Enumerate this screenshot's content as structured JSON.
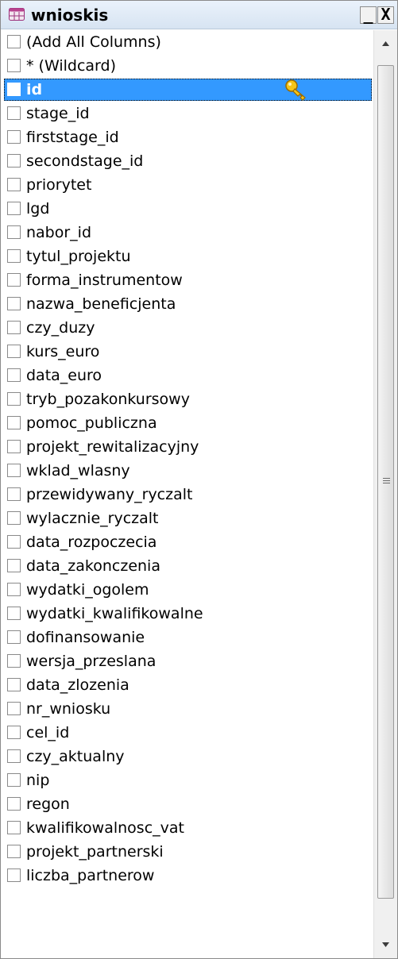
{
  "window": {
    "title": "wnioskis",
    "icon": "table-icon",
    "minimize_label": "_",
    "close_label": "X"
  },
  "columns": {
    "selected_index": 2,
    "items": [
      {
        "label": "(Add All Columns)",
        "checked": false
      },
      {
        "label": "* (Wildcard)",
        "checked": false
      },
      {
        "label": "id",
        "checked": false,
        "primary_key": true
      },
      {
        "label": "stage_id",
        "checked": false
      },
      {
        "label": "firststage_id",
        "checked": false
      },
      {
        "label": "secondstage_id",
        "checked": false
      },
      {
        "label": "priorytet",
        "checked": false
      },
      {
        "label": "lgd",
        "checked": false
      },
      {
        "label": "nabor_id",
        "checked": false
      },
      {
        "label": "tytul_projektu",
        "checked": false
      },
      {
        "label": "forma_instrumentow",
        "checked": false
      },
      {
        "label": "nazwa_beneficjenta",
        "checked": false
      },
      {
        "label": "czy_duzy",
        "checked": false
      },
      {
        "label": "kurs_euro",
        "checked": false
      },
      {
        "label": "data_euro",
        "checked": false
      },
      {
        "label": "tryb_pozakonkursowy",
        "checked": false
      },
      {
        "label": "pomoc_publiczna",
        "checked": false
      },
      {
        "label": "projekt_rewitalizacyjny",
        "checked": false
      },
      {
        "label": "wklad_wlasny",
        "checked": false
      },
      {
        "label": "przewidywany_ryczalt",
        "checked": false
      },
      {
        "label": "wylacznie_ryczalt",
        "checked": false
      },
      {
        "label": "data_rozpoczecia",
        "checked": false
      },
      {
        "label": "data_zakonczenia",
        "checked": false
      },
      {
        "label": "wydatki_ogolem",
        "checked": false
      },
      {
        "label": "wydatki_kwalifikowalne",
        "checked": false
      },
      {
        "label": "dofinansowanie",
        "checked": false
      },
      {
        "label": "wersja_przeslana",
        "checked": false
      },
      {
        "label": "data_zlozenia",
        "checked": false
      },
      {
        "label": "nr_wniosku",
        "checked": false
      },
      {
        "label": "cel_id",
        "checked": false
      },
      {
        "label": "czy_aktualny",
        "checked": false
      },
      {
        "label": "nip",
        "checked": false
      },
      {
        "label": "regon",
        "checked": false
      },
      {
        "label": "kwalifikowalnosc_vat",
        "checked": false
      },
      {
        "label": "projekt_partnerski",
        "checked": false
      },
      {
        "label": "liczba_partnerow",
        "checked": false
      }
    ]
  },
  "colors": {
    "selection": "#3399ff",
    "titlebar": "#dde8f5",
    "key": "#f5c518"
  },
  "icons": {
    "key": "key-icon",
    "scroll_up": "scroll-up-arrow-icon",
    "scroll_down": "scroll-down-arrow-icon",
    "grip": "scrollbar-grip-icon"
  }
}
